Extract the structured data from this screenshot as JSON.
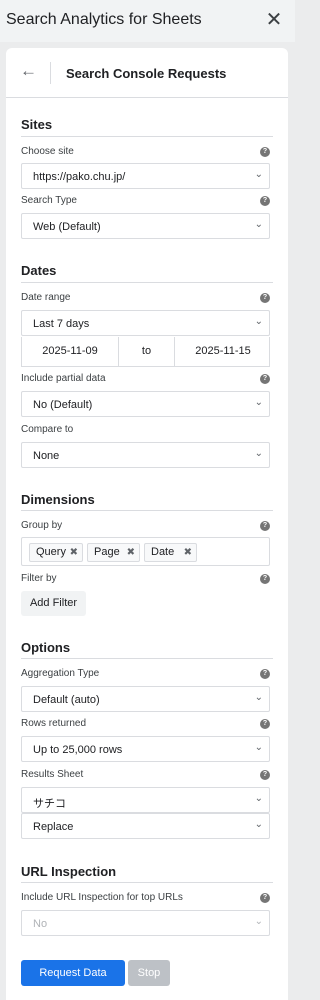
{
  "app": {
    "title": "Search Analytics for Sheets",
    "close_glyph": "✕"
  },
  "header": {
    "back_glyph": "←",
    "title": "Search Console Requests"
  },
  "sites": {
    "section_title": "Sites",
    "choose_site_label": "Choose site",
    "choose_site_value": "https://pako.chu.jp/",
    "search_type_label": "Search Type",
    "search_type_value": "Web (Default)"
  },
  "dates": {
    "section_title": "Dates",
    "date_range_label": "Date range",
    "date_range_value": "Last 7 days",
    "start_date": "2025-11-09",
    "to_label": "to",
    "end_date": "2025-11-15",
    "partial_label": "Include partial data",
    "partial_value": "No (Default)",
    "compare_label": "Compare to",
    "compare_value": "None"
  },
  "dimensions": {
    "section_title": "Dimensions",
    "group_by_label": "Group by",
    "chips": [
      "Query",
      "Page",
      "Date"
    ],
    "chip_remove_glyph": "✖",
    "filter_by_label": "Filter by",
    "add_filter_label": "Add Filter"
  },
  "options": {
    "section_title": "Options",
    "aggregation_label": "Aggregation Type",
    "aggregation_value": "Default (auto)",
    "rows_label": "Rows returned",
    "rows_value": "Up to 25,000 rows",
    "results_sheet_label": "Results Sheet",
    "results_sheet_value": "サチコ",
    "write_mode_value": "Replace"
  },
  "url_inspection": {
    "section_title": "URL Inspection",
    "include_label": "Include URL Inspection for top URLs",
    "include_value": "No"
  },
  "actions": {
    "request_label": "Request Data",
    "stop_label": "Stop"
  },
  "glyphs": {
    "chevron": "⌄",
    "help": "?"
  },
  "colors": {
    "primary": "#1a73e8",
    "disabled_button": "#bdc1c6",
    "background": "#ebeced"
  }
}
